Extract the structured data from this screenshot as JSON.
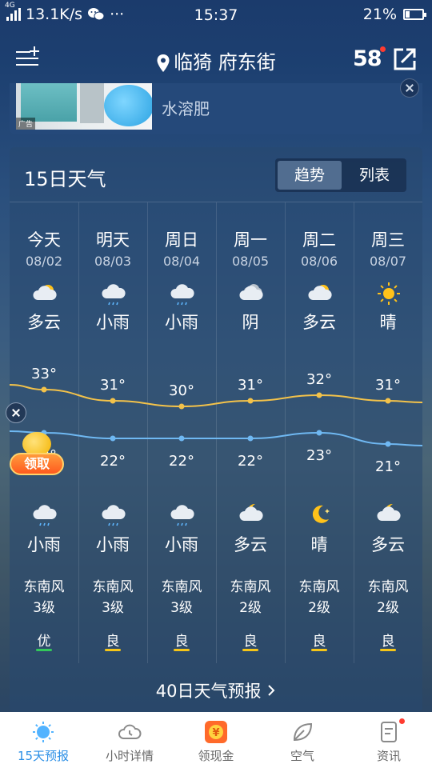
{
  "status": {
    "network_gen": "4G",
    "speed": "13.1K/s",
    "wechat_icon": "wechat-icon",
    "dots": "···",
    "time": "15:37",
    "battery": "21%"
  },
  "header": {
    "location": "临猗 府东街",
    "brand": "58"
  },
  "ad": {
    "text": "水溶肥",
    "tag": "广告"
  },
  "forecast": {
    "title": "15日天气",
    "tabs": [
      "趋势",
      "列表"
    ],
    "more_label": "40日天气预报",
    "days": [
      {
        "name": "今天",
        "date": "08/02",
        "day_icon": "partly-cloudy-icon",
        "day": "多云",
        "high": "33°",
        "low": "23°",
        "night_icon": "light-rain-icon",
        "night": "小雨",
        "wind": "东南风",
        "level": "3级",
        "aqi": "优",
        "aqi_color": "#32c85a"
      },
      {
        "name": "明天",
        "date": "08/03",
        "day_icon": "light-rain-icon",
        "day": "小雨",
        "high": "31°",
        "low": "22°",
        "night_icon": "light-rain-icon",
        "night": "小雨",
        "wind": "东南风",
        "level": "3级",
        "aqi": "良",
        "aqi_color": "#f5c518"
      },
      {
        "name": "周日",
        "date": "08/04",
        "day_icon": "light-rain-icon",
        "day": "小雨",
        "high": "30°",
        "low": "22°",
        "night_icon": "light-rain-icon",
        "night": "小雨",
        "wind": "东南风",
        "level": "3级",
        "aqi": "良",
        "aqi_color": "#f5c518"
      },
      {
        "name": "周一",
        "date": "08/05",
        "day_icon": "overcast-icon",
        "day": "阴",
        "high": "31°",
        "low": "22°",
        "night_icon": "cloudy-night-icon",
        "night": "多云",
        "wind": "东南风",
        "level": "2级",
        "aqi": "良",
        "aqi_color": "#f5c518"
      },
      {
        "name": "周二",
        "date": "08/06",
        "day_icon": "partly-cloudy-icon",
        "day": "多云",
        "high": "32°",
        "low": "23°",
        "night_icon": "moon-icon",
        "night": "晴",
        "wind": "东南风",
        "level": "2级",
        "aqi": "良",
        "aqi_color": "#f5c518"
      },
      {
        "name": "周三",
        "date": "08/07",
        "day_icon": "sun-icon",
        "day": "晴",
        "high": "31°",
        "low": "21°",
        "night_icon": "cloudy-night-icon",
        "night": "多云",
        "wind": "东南风",
        "level": "2级",
        "aqi": "良",
        "aqi_color": "#f5c518"
      }
    ]
  },
  "promo": {
    "label": "领取",
    "coin_symbol": "¥"
  },
  "nav": [
    {
      "label": "15天预报",
      "icon": "sun-icon",
      "active": true
    },
    {
      "label": "小时详情",
      "icon": "cloud-icon",
      "active": false
    },
    {
      "label": "领现金",
      "icon": "cash-icon",
      "active": false
    },
    {
      "label": "空气",
      "icon": "leaf-icon",
      "active": false
    },
    {
      "label": "资讯",
      "icon": "news-icon",
      "active": false,
      "badge": true
    }
  ],
  "colors": {
    "high_line": "#f3c24a",
    "low_line": "#6fb8f2",
    "accent": "#2b8fe6"
  }
}
